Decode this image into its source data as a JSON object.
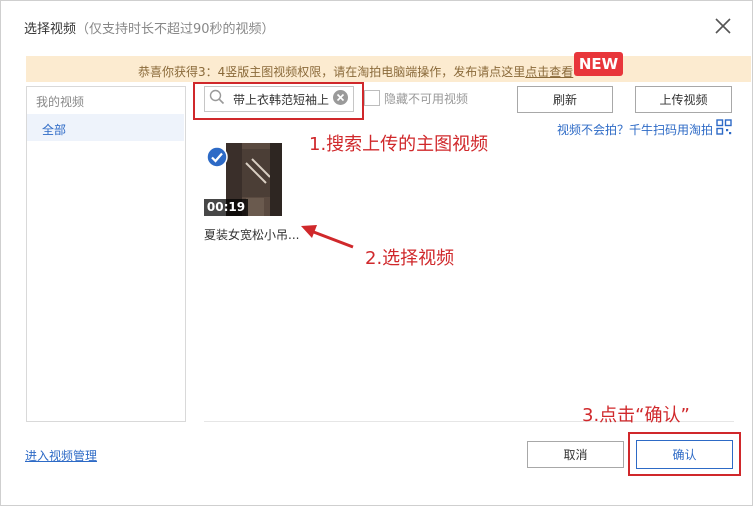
{
  "dialog": {
    "title": "选择视频",
    "subtitle": "（仅支持时长不超过90秒的视频）"
  },
  "banner": {
    "text": "恭喜你获得3：4竖版主图视频权限，请在淘拍电脑端操作，发布请点这里",
    "link_text": "点击查看",
    "badge": "NEW"
  },
  "sidebar": {
    "header": "我的视频",
    "items": [
      {
        "label": "全部",
        "selected": true
      }
    ]
  },
  "toolbar": {
    "search_value": "夏装女宽松小吊带上衣韩范短袖上",
    "hide_unavailable_label": "隐藏不可用视频",
    "hide_unavailable_checked": false,
    "refresh_label": "刷新",
    "upload_label": "上传视频",
    "help_link": "视频不会拍？千牛扫码用淘拍"
  },
  "videos": [
    {
      "duration": "00:19",
      "name": "夏装女宽松小吊...",
      "selected": true
    }
  ],
  "annotations": {
    "step1": "1.搜索上传的主图视频",
    "step2": "2.选择视频",
    "step3": "3.点击“确认”"
  },
  "footer": {
    "manage_link": "进入视频管理",
    "cancel_label": "取消",
    "confirm_label": "确认"
  },
  "colors": {
    "accent_blue": "#2d6ac6",
    "annotation_red": "#d0282b",
    "badge_red": "#e8363b",
    "banner_bg": "#fcebd0"
  }
}
